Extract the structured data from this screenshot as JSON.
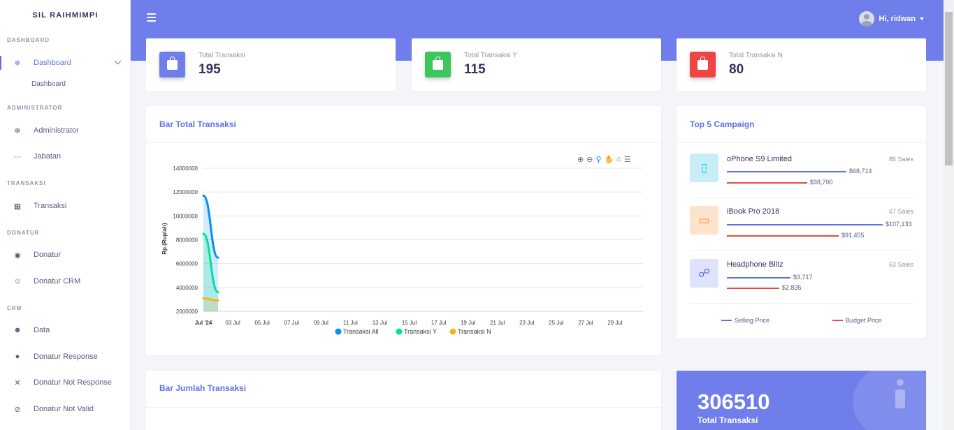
{
  "brand": "SIL RAIHMIMPI",
  "sidebar": {
    "sections": [
      {
        "heading": "DASHBOARD"
      },
      {
        "heading": "ADMINISTRATOR"
      },
      {
        "heading": "TRANSAKSI"
      },
      {
        "heading": "DONATUR"
      },
      {
        "heading": "CRM"
      }
    ],
    "items": [
      {
        "label": "Dashboard",
        "icon": "fire-icon"
      },
      {
        "label": "Administrator",
        "icon": "fire-icon"
      },
      {
        "label": "Jabatan",
        "icon": "dots-icon"
      },
      {
        "label": "Transaksi",
        "icon": "table-icon"
      },
      {
        "label": "Donatur",
        "icon": "user-badge-icon"
      },
      {
        "label": "Donatur CRM",
        "icon": "users-icon"
      },
      {
        "label": "Data",
        "icon": "group-icon"
      },
      {
        "label": "Donatur Response",
        "icon": "user-icon"
      },
      {
        "label": "Donatur Not Response",
        "icon": "user-x-icon"
      },
      {
        "label": "Donatur Not Valid",
        "icon": "user-slash-icon"
      }
    ],
    "subitem": "Dashboard"
  },
  "header": {
    "user_greeting": "Hi, ridwan"
  },
  "stats": [
    {
      "label": "Total Transaksi",
      "value": "195",
      "color": "#5e72e4"
    },
    {
      "label": "Total Transaksi Y",
      "value": "115",
      "color": "#2dce89"
    },
    {
      "label": "Total Transaksi N",
      "value": "80",
      "color": "#f5365c"
    }
  ],
  "bar_total": {
    "title": "Bar Total Transaksi"
  },
  "chart_data": {
    "type": "area",
    "title": "",
    "ylabel": "Rp.(Rupiah)",
    "xlabel": "",
    "ylim": [
      2000000,
      14000000
    ],
    "yticks": [
      "14000000",
      "12000000",
      "10000000",
      "8000000",
      "6000000",
      "4000000",
      "2000000"
    ],
    "xticks": [
      "Jul '24",
      "03 Jul",
      "05 Jul",
      "07 Jul",
      "09 Jul",
      "11 Jul",
      "13 Jul",
      "15 Jul",
      "17 Jul",
      "19 Jul",
      "21 Jul",
      "23 Jul",
      "25 Jul",
      "27 Jul",
      "29 Jul"
    ],
    "x": [
      "2024-07-01",
      "2024-07-02"
    ],
    "series": [
      {
        "name": "Transaksi All",
        "color": "#008ffb",
        "values": [
          11700000,
          6500000
        ]
      },
      {
        "name": "Transaksi Y",
        "color": "#00e396",
        "values": [
          8500000,
          3600000
        ]
      },
      {
        "name": "Transaksi N",
        "color": "#feb019",
        "values": [
          3100000,
          2900000
        ]
      }
    ]
  },
  "campaign": {
    "title": "Top 5 Campaign",
    "items": [
      {
        "name": "oPhone S9 Limited",
        "sales": "86 Sales",
        "selling": "$68,714",
        "budget": "$38,700",
        "icon": "phone-icon",
        "bg": "#c7eef7",
        "fg": "#11cdef"
      },
      {
        "name": "iBook Pro 2018",
        "sales": "67 Sales",
        "selling": "$107,133",
        "budget": "$91,455",
        "icon": "laptop-icon",
        "bg": "#fde2cc",
        "fg": "#fb8c3a"
      },
      {
        "name": "Headphone Blitz",
        "sales": "63 Sales",
        "selling": "$3,717",
        "budget": "$2,835",
        "icon": "headphone-icon",
        "bg": "#dfe3fb",
        "fg": "#5e72e4"
      }
    ],
    "legend": {
      "selling": "Selling Price",
      "budget": "Budget Price",
      "selling_color": "#5e72e4",
      "budget_color": "#e74c3c"
    }
  },
  "bar_jumlah": {
    "title": "Bar Jumlah Transaksi"
  },
  "info": {
    "value": "306510",
    "label": "Total Transaksi"
  }
}
